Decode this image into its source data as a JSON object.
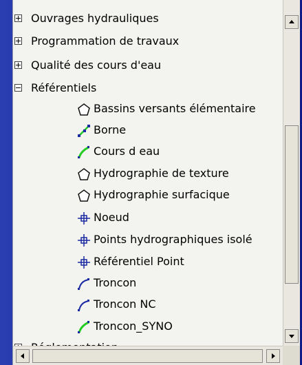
{
  "tree": {
    "groups": [
      {
        "label": "Ouvrages hydrauliques",
        "expanded": false
      },
      {
        "label": "Programmation de travaux",
        "expanded": false
      },
      {
        "label": "Qualité des cours d'eau",
        "expanded": false
      },
      {
        "label": "Référentiels",
        "expanded": true
      }
    ],
    "children": [
      {
        "label": "Bassins versants élémentaire",
        "icon": "polygon-icon"
      },
      {
        "label": "Borne",
        "icon": "line-points-icon"
      },
      {
        "label": "Cours d eau",
        "icon": "line-icon"
      },
      {
        "label": "Hydrographie de texture",
        "icon": "polygon-icon"
      },
      {
        "label": "Hydrographie surfacique",
        "icon": "polygon-icon"
      },
      {
        "label": "Noeud",
        "icon": "point-crosshair-icon"
      },
      {
        "label": "Points hydrographiques isolé",
        "icon": "point-crosshair-icon"
      },
      {
        "label": "Référentiel Point",
        "icon": "point-crosshair-icon"
      },
      {
        "label": "Troncon",
        "icon": "curve-icon"
      },
      {
        "label": "Troncon NC",
        "icon": "curve-icon"
      },
      {
        "label": "Troncon_SYNO",
        "icon": "line-icon"
      }
    ],
    "partial_last": {
      "label": "Réglementation"
    }
  },
  "colors": {
    "background": "#1a2aa0",
    "panel": "#f3f3ef",
    "line_green": "#22cc22",
    "line_blue": "#1a2aa0"
  }
}
